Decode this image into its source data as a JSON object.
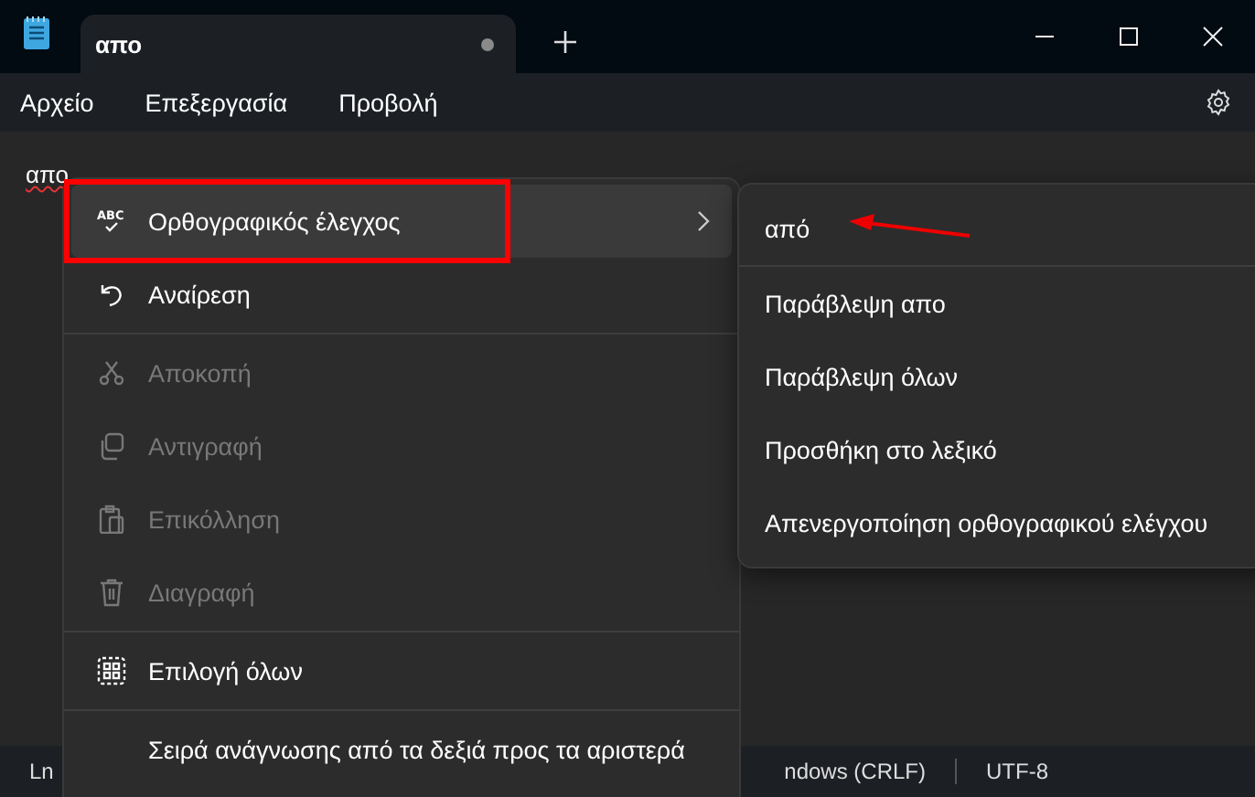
{
  "tab": {
    "title": "απο",
    "modified": true
  },
  "menu_bar": [
    "Αρχείο",
    "Επεξεργασία",
    "Προβολή"
  ],
  "editor": {
    "text": "απο",
    "misspelled": true
  },
  "context_menu": [
    {
      "kind": "item",
      "icon_text": "ABC",
      "label": "Ορθογραφικός έλεγχος",
      "selected": true,
      "disabled": false,
      "submenu": true,
      "annotated": true
    },
    {
      "kind": "item",
      "label": "Αναίρεση",
      "selected": false,
      "disabled": false,
      "submenu": false,
      "annotated": false
    },
    {
      "kind": "separator"
    },
    {
      "kind": "item",
      "label": "Αποκοπή",
      "selected": false,
      "disabled": true,
      "submenu": false,
      "annotated": false
    },
    {
      "kind": "item",
      "label": "Αντιγραφή",
      "selected": false,
      "disabled": true,
      "submenu": false,
      "annotated": false
    },
    {
      "kind": "item",
      "label": "Επικόλληση",
      "selected": false,
      "disabled": true,
      "submenu": false,
      "annotated": false
    },
    {
      "kind": "item",
      "label": "Διαγραφή",
      "selected": false,
      "disabled": true,
      "submenu": false,
      "annotated": false
    },
    {
      "kind": "separator"
    },
    {
      "kind": "item",
      "label": "Επιλογή όλων",
      "selected": false,
      "disabled": false,
      "submenu": false,
      "annotated": false
    },
    {
      "kind": "separator"
    },
    {
      "kind": "item",
      "label": "Σειρά ανάγνωσης από τα δεξιά προς τα αριστερά",
      "selected": false,
      "disabled": false,
      "submenu": false,
      "annotated": false
    }
  ],
  "submenu": [
    {
      "kind": "item",
      "label": "από",
      "annotated": true
    },
    {
      "kind": "separator"
    },
    {
      "kind": "item",
      "label": "Παράβλεψη απο",
      "annotated": false
    },
    {
      "kind": "item",
      "label": "Παράβλεψη όλων",
      "annotated": false
    },
    {
      "kind": "item",
      "label": "Προσθήκη στο λεξικό",
      "annotated": false
    },
    {
      "kind": "item",
      "label": "Απενεργοποίηση ορθογραφικού ελέγχου",
      "annotated": false
    }
  ],
  "status_bar": [
    "Ln",
    "ndows (CRLF)",
    "UTF-8"
  ]
}
